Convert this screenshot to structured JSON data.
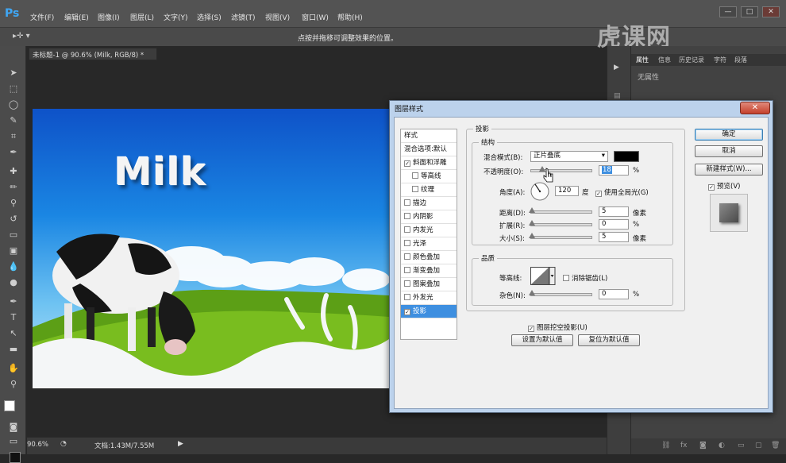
{
  "app": {
    "logo": "Ps",
    "menu": [
      "文件(F)",
      "编辑(E)",
      "图像(I)",
      "图层(L)",
      "文字(Y)",
      "选择(S)",
      "滤镜(T)",
      "视图(V)",
      "窗口(W)",
      "帮助(H)"
    ],
    "window_buttons": [
      "—",
      "□",
      "✕"
    ]
  },
  "options": {
    "hint": "点按并拖移可调整效果的位置。"
  },
  "document": {
    "tab_title": "未标题-1 @ 90.6% (Milk, RGB/8) *",
    "tab_close": "×",
    "canvas_text": "Milk",
    "zoom": "90.6%",
    "doc_size": "文档:1.43M/7.55M"
  },
  "panel": {
    "tabs": [
      "属性",
      "信息",
      "历史记录",
      "字符",
      "段落"
    ],
    "empty_text": "无属性"
  },
  "watermark": "虎课网",
  "dialog": {
    "title": "图层样式",
    "close": "✕",
    "styles_header": "样式",
    "blend_default": "混合选项:默认",
    "styles": [
      {
        "label": "斜面和浮雕",
        "checked": true,
        "sub": false
      },
      {
        "label": "等高线",
        "checked": false,
        "sub": true
      },
      {
        "label": "纹理",
        "checked": false,
        "sub": true
      },
      {
        "label": "描边",
        "checked": false,
        "sub": false
      },
      {
        "label": "内阴影",
        "checked": false,
        "sub": false
      },
      {
        "label": "内发光",
        "checked": false,
        "sub": false
      },
      {
        "label": "光泽",
        "checked": false,
        "sub": false
      },
      {
        "label": "颜色叠加",
        "checked": false,
        "sub": false
      },
      {
        "label": "渐变叠加",
        "checked": false,
        "sub": false
      },
      {
        "label": "图案叠加",
        "checked": false,
        "sub": false
      },
      {
        "label": "外发光",
        "checked": false,
        "sub": false
      },
      {
        "label": "投影",
        "checked": true,
        "sub": false,
        "selected": true
      }
    ],
    "section_title": "投影",
    "structure": {
      "legend": "结构",
      "blend_mode_label": "混合模式(B):",
      "blend_mode_value": "正片叠底",
      "blend_color": "#000000",
      "opacity_label": "不透明度(O):",
      "opacity_value": "18",
      "opacity_fraction": 0.18,
      "percent": "%",
      "angle_label": "角度(A):",
      "angle_value": "120",
      "angle_unit": "度",
      "global_light_label": "使用全局光(G)",
      "global_light_checked": true,
      "distance_label": "距离(D):",
      "distance_value": "5",
      "spread_label": "扩展(R):",
      "spread_value": "0",
      "size_label": "大小(S):",
      "size_value": "5",
      "px_unit": "像素"
    },
    "quality": {
      "legend": "品质",
      "contour_label": "等高线:",
      "anti_alias_label": "消除锯齿(L)",
      "noise_label": "杂色(N):",
      "noise_value": "0"
    },
    "knockout_label": "图层挖空投影(U)",
    "make_default": "设置为默认值",
    "reset_default": "复位为默认值",
    "buttons": {
      "ok": "确定",
      "cancel": "取消",
      "new_style": "新建样式(W)...",
      "preview": "预览(V)"
    }
  }
}
